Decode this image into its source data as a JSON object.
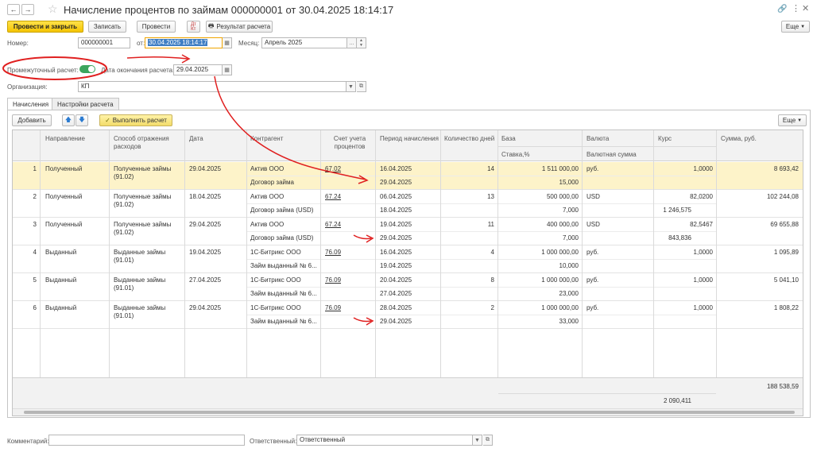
{
  "window": {
    "title": "Начисление процентов по займам 000000001 от 30.04.2025 18:14:17",
    "more_label": "Еще"
  },
  "toolbar": {
    "post_close_label": "Провести и закрыть",
    "save_label": "Записать",
    "post_label": "Провести",
    "result_label": "Результат расчета"
  },
  "header": {
    "number_label": "Номер:",
    "number_value": "000000001",
    "from_label": "от:",
    "date_value": "30.04.2025 18:14:17",
    "month_label": "Месяц:",
    "month_value": "Апрель 2025",
    "interim_label": "Промежуточный расчет:",
    "interim_on": true,
    "end_date_label": "Дата окончания расчета:",
    "end_date_value": "29.04.2025",
    "org_label": "Организация:",
    "org_value": "КП"
  },
  "tabs": [
    {
      "label": "Начисления"
    },
    {
      "label": "Настройки расчета"
    }
  ],
  "grid_toolbar": {
    "add_label": "Добавить",
    "calc_label": "Выполнить расчет",
    "more_label": "Еще"
  },
  "columns": {
    "direction": "Направление",
    "reflection": "Способ отражения расходов",
    "date": "Дата",
    "counterparty": "Контрагент",
    "account": "Счет учета процентов",
    "period": "Период начисления",
    "days": "Количество дней",
    "base": "База",
    "rate": "Ставка,%",
    "currency": "Валюта",
    "currency_sum": "Валютная сумма",
    "course": "Курс",
    "sum": "Сумма, руб."
  },
  "rows": [
    {
      "n": "1",
      "direction": "Полученный",
      "reflection": "Полученные займы (91.02)",
      "date": "29.04.2025",
      "counterparty": "Актив ООО",
      "contract": "Договор займа",
      "account": "67.02",
      "period_from": "16.04.2025",
      "period_to": "29.04.2025",
      "days": "14",
      "base": "1 511 000,00",
      "rate": "15,000",
      "currency": "руб.",
      "currency_sum": "",
      "course": "1,0000",
      "sum": "8 693,42"
    },
    {
      "n": "2",
      "direction": "Полученный",
      "reflection": "Полученные займы (91.02)",
      "date": "18.04.2025",
      "counterparty": "Актив ООО",
      "contract": "Договор займа (USD)",
      "account": "67.24",
      "period_from": "06.04.2025",
      "period_to": "18.04.2025",
      "days": "13",
      "base": "500 000,00",
      "rate": "7,000",
      "currency": "USD",
      "currency_sum": "1 246,575",
      "course": "82,0200",
      "sum": "102 244,08"
    },
    {
      "n": "3",
      "direction": "Полученный",
      "reflection": "Полученные займы (91.02)",
      "date": "29.04.2025",
      "counterparty": "Актив ООО",
      "contract": "Договор займа (USD)",
      "account": "67.24",
      "period_from": "19.04.2025",
      "period_to": "29.04.2025",
      "days": "11",
      "base": "400 000,00",
      "rate": "7,000",
      "currency": "USD",
      "currency_sum": "843,836",
      "course": "82,5467",
      "sum": "69 655,88"
    },
    {
      "n": "4",
      "direction": "Выданный",
      "reflection": "Выданные займы (91.01)",
      "date": "19.04.2025",
      "counterparty": "1С-Битрикс ООО",
      "contract": "Займ выданный № 6...",
      "account": "76.09",
      "period_from": "16.04.2025",
      "period_to": "19.04.2025",
      "days": "4",
      "base": "1 000 000,00",
      "rate": "10,000",
      "currency": "руб.",
      "currency_sum": "",
      "course": "1,0000",
      "sum": "1 095,89"
    },
    {
      "n": "5",
      "direction": "Выданный",
      "reflection": "Выданные займы (91.01)",
      "date": "27.04.2025",
      "counterparty": "1С-Битрикс ООО",
      "contract": "Займ выданный № 6...",
      "account": "76.09",
      "period_from": "20.04.2025",
      "period_to": "27.04.2025",
      "days": "8",
      "base": "1 000 000,00",
      "rate": "23,000",
      "currency": "руб.",
      "currency_sum": "",
      "course": "1,0000",
      "sum": "5 041,10"
    },
    {
      "n": "6",
      "direction": "Выданный",
      "reflection": "Выданные займы (91.01)",
      "date": "29.04.2025",
      "counterparty": "1С-Битрикс ООО",
      "contract": "Займ выданный № 6...",
      "account": "76.09",
      "period_from": "28.04.2025",
      "period_to": "29.04.2025",
      "days": "2",
      "base": "1 000 000,00",
      "rate": "33,000",
      "currency": "руб.",
      "currency_sum": "",
      "course": "1,0000",
      "sum": "1 808,22"
    }
  ],
  "totals": {
    "sum": "188 538,59",
    "currency_sum": "2 090,411"
  },
  "bottom": {
    "comment_label": "Комментарий:",
    "comment_value": "",
    "responsible_label": "Ответственный:",
    "responsible_value": "Ответственный"
  },
  "colors": {
    "annotation": "#e02020",
    "accent": "#f5c400",
    "selected_row": "#fdf3c9",
    "toggle_on": "#3da55d"
  }
}
